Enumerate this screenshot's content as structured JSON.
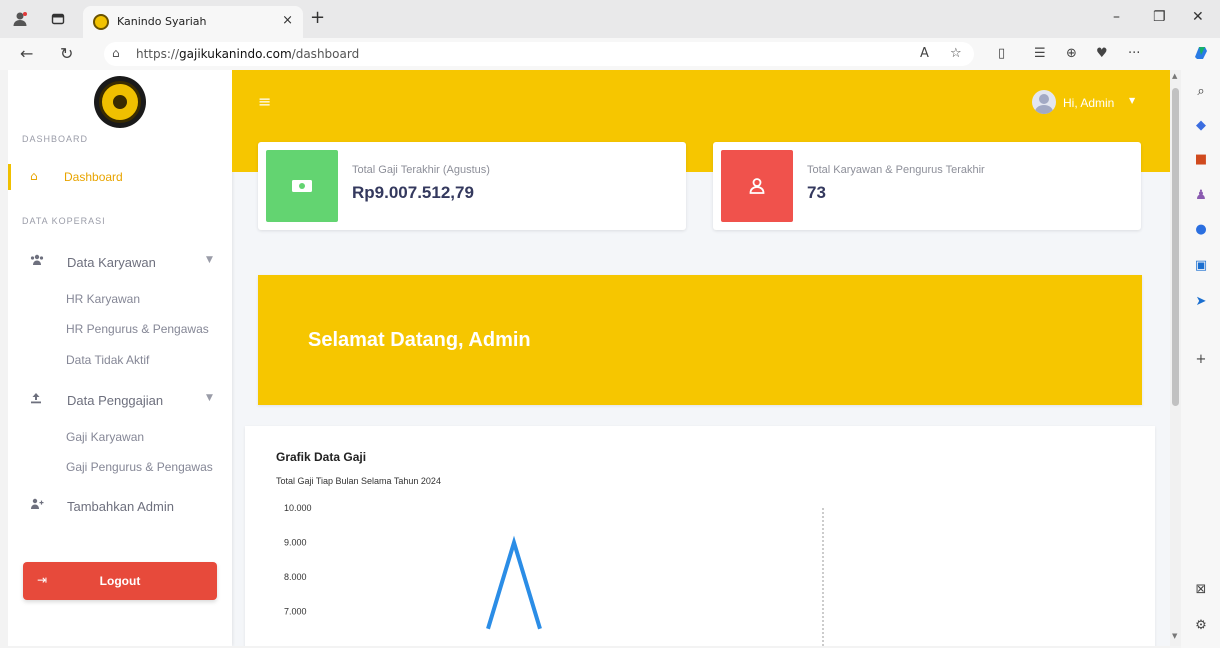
{
  "browser": {
    "tab_title": "Kanindo Syariah",
    "url_prefix": "https://",
    "url_domain": "gajikukanindo.com",
    "url_path": "/dashboard",
    "new_tab_glyph": "+",
    "close_tab_glyph": "×"
  },
  "sidebar": {
    "dashboard_heading": "DASHBOARD",
    "active_item": "Dashboard",
    "data_heading": "DATA KOPERASI",
    "menu": [
      {
        "label": "Data Karyawan",
        "icon": "users-icon",
        "sub": [
          "HR Karyawan",
          "HR Pengurus & Pengawas",
          "Data Tidak Aktif"
        ]
      },
      {
        "label": "Data Penggajian",
        "icon": "upload-icon",
        "sub": [
          "Gaji Karyawan",
          "Gaji Pengurus & Pengawas"
        ]
      },
      {
        "label": "Tambahkan Admin",
        "icon": "user-plus-icon",
        "sub": []
      }
    ],
    "logout_label": "Logout"
  },
  "topbar": {
    "greeting": "Hi, Admin"
  },
  "cards": [
    {
      "label": "Total Gaji Terakhir (Agustus)",
      "value": "Rp9.007.512,79",
      "icon": "money-icon",
      "color": "#63d471"
    },
    {
      "label": "Total Karyawan & Pengurus Terakhir",
      "value": "73",
      "icon": "user-icon",
      "color": "#f0524c"
    }
  ],
  "banner": {
    "text": "Selamat Datang, Admin"
  },
  "chart": {
    "title": "Grafik Data Gaji",
    "subtitle": "Total Gaji Tiap Bulan Selama Tahun 2024"
  },
  "chart_data": {
    "type": "line",
    "title": "Grafik Data Gaji",
    "subtitle": "Total Gaji Tiap Bulan Selama Tahun 2024",
    "y_ticks": [
      "10.000",
      "9.000",
      "8.000",
      "7.000"
    ],
    "ylim_visible": [
      6500,
      10000
    ],
    "series": [
      {
        "color": "#2b8de6",
        "points": [
          [
            0,
            6500
          ],
          [
            1,
            9000
          ],
          [
            2,
            6500
          ]
        ]
      }
    ],
    "x_index_range": [
      0,
      7
    ],
    "marker_index": 5
  },
  "colors": {
    "accent": "#f6c600",
    "active_text": "#e8a400",
    "logout": "#e74a3b",
    "line": "#2b8de6"
  }
}
